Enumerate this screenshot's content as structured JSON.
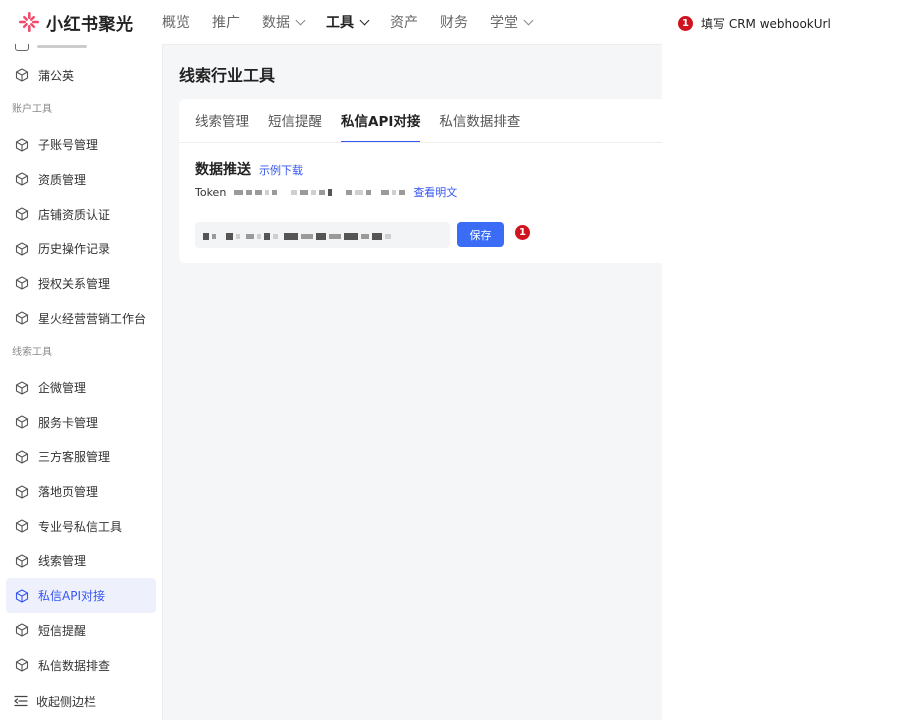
{
  "brand": {
    "name": "小红书聚光"
  },
  "topnav": [
    {
      "label": "概览",
      "dropdown": false,
      "active": false
    },
    {
      "label": "推广",
      "dropdown": false,
      "active": false
    },
    {
      "label": "数据",
      "dropdown": true,
      "active": false
    },
    {
      "label": "工具",
      "dropdown": true,
      "active": true
    },
    {
      "label": "资产",
      "dropdown": false,
      "active": false
    },
    {
      "label": "财务",
      "dropdown": false,
      "active": false
    },
    {
      "label": "学堂",
      "dropdown": true,
      "active": false
    }
  ],
  "sidebar": {
    "items_top": [
      {
        "label": "蒲公英"
      }
    ],
    "group_account": "账户工具",
    "items_account": [
      {
        "label": "子账号管理"
      },
      {
        "label": "资质管理"
      },
      {
        "label": "店铺资质认证"
      },
      {
        "label": "历史操作记录"
      },
      {
        "label": "授权关系管理"
      },
      {
        "label": "星火经营营销工作台"
      }
    ],
    "group_leads": "线索工具",
    "items_leads": [
      {
        "label": "企微管理",
        "active": false
      },
      {
        "label": "服务卡管理",
        "active": false
      },
      {
        "label": "三方客服管理",
        "active": false
      },
      {
        "label": "落地页管理",
        "active": false
      },
      {
        "label": "专业号私信工具",
        "active": false
      },
      {
        "label": "线索管理",
        "active": false
      },
      {
        "label": "私信API对接",
        "active": true
      },
      {
        "label": "短信提醒",
        "active": false
      },
      {
        "label": "私信数据排查",
        "active": false
      }
    ],
    "collapse_label": "收起侧边栏"
  },
  "page": {
    "title": "线索行业工具",
    "tabs": [
      {
        "label": "线索管理",
        "active": false
      },
      {
        "label": "短信提醒",
        "active": false
      },
      {
        "label": "私信API对接",
        "active": true
      },
      {
        "label": "私信数据排查",
        "active": false
      }
    ],
    "section_title": "数据推送",
    "example_link": "示例下载",
    "token_label": "Token",
    "token_view_link": "查看明文",
    "save_button": "保存",
    "badge_number": "1"
  },
  "annotation": {
    "badge_number": "1",
    "text": "填写 CRM webhookUrl"
  },
  "colors": {
    "accent": "#3656f4",
    "badge": "#d0141f",
    "brand_petal": "#f44a6a"
  },
  "icons": {
    "logo": "pinwheel-logo-icon",
    "sidebar_item": "cube-icon",
    "collapse": "collapse-sidebar-icon"
  }
}
